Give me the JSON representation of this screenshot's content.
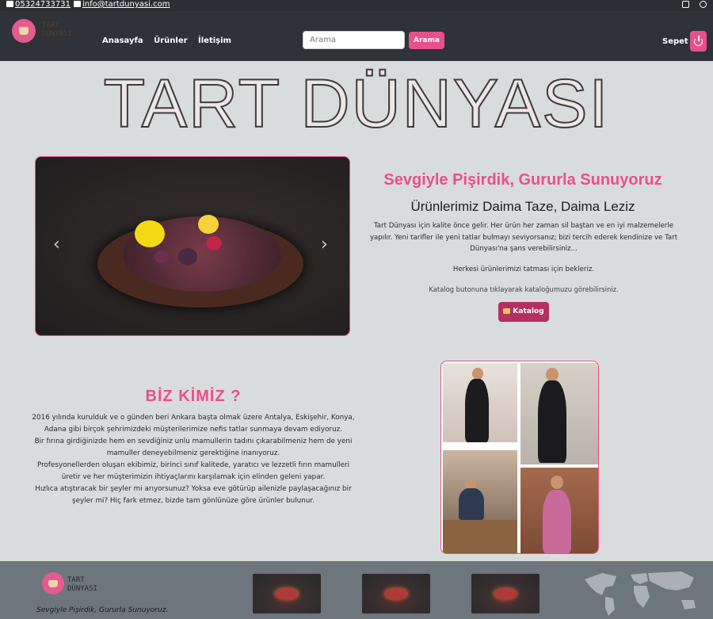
{
  "topbar": {
    "phone": "05324733731",
    "email": "info@tartdunyasi.com",
    "instagram_icon": "instagram-icon",
    "facebook_icon": "facebook-icon"
  },
  "navbar": {
    "logo_line1": "TART",
    "logo_line2": "DÜNYASI",
    "links": [
      "Anasayfa",
      "Ürünler",
      "İletişim"
    ],
    "search_placeholder": "Arama",
    "search_button": "Arama",
    "cart": "Sepet",
    "power_icon": "power-icon"
  },
  "hero": {
    "big_title": "TART DÜNYASI",
    "slogan": "Sevgiyle Pişirdik, Gururla Sunuyoruz",
    "subtitle": "Ürünlerimiz Daima Taze, Daima Leziz",
    "description": "Tart Dünyası için kalite önce gelir. Her ürün her zaman sil baştan ve en iyi malzemelerle yapılır. Yeni tarifler ile yeni tatlar bulmayı seviyorsanız; bizi tercih ederek kendinize ve Tart Dünyası'na şans verebilirsiniz...",
    "welcome": "Herkesi ürünlerimizi tatması için bekleriz.",
    "catalog_note": "Katalog butonuna tıklayarak kataloğumuzu görebilirsiniz.",
    "catalog_button": "Katalog",
    "slider_prev": "‹",
    "slider_next": "›"
  },
  "about": {
    "title": "BİZ KİMİZ ?",
    "p1": "2016 yılında kurulduk ve o günden beri Ankara başta olmak üzere Antalya, Eskişehir, Konya, Adana gibi birçok şehrimizdeki müşterilerimize nefis tatlar sunmaya devam ediyoruz.",
    "p2": "Bir fırına girdiğinizde hem en sevdiğiniz unlu mamullerin tadını çıkarabilmeniz hem de yeni mamuller deneyebilmeniz gerektiğine inanıyoruz.",
    "p3": "Profesyonellerden oluşan ekibimiz, birinci sınıf kalitede, yaratıcı ve lezzetli fırın mamulleri üretir ve her müşterimizin ihtiyaçlarını karşılamak için elinden geleni yapar.",
    "p4": "Hızlıca atıştıracak bir şeyler mi arıyorsunuz? Yoksa eve götürüp ailenizle paylaşacağınız bir şeyler mi? Hiç fark etmez, bizde tam gönlünüze göre ürünler bulunur."
  },
  "footer": {
    "logo_line1": "TART",
    "logo_line2": "DÜNYASI",
    "slogan": "Sevgiyle Pişirdik, Gururla Sunuyoruz."
  },
  "colors": {
    "accent": "#e8508a",
    "catalog": "#b33060",
    "navbar": "#2f3237",
    "footer": "#6d757d"
  }
}
